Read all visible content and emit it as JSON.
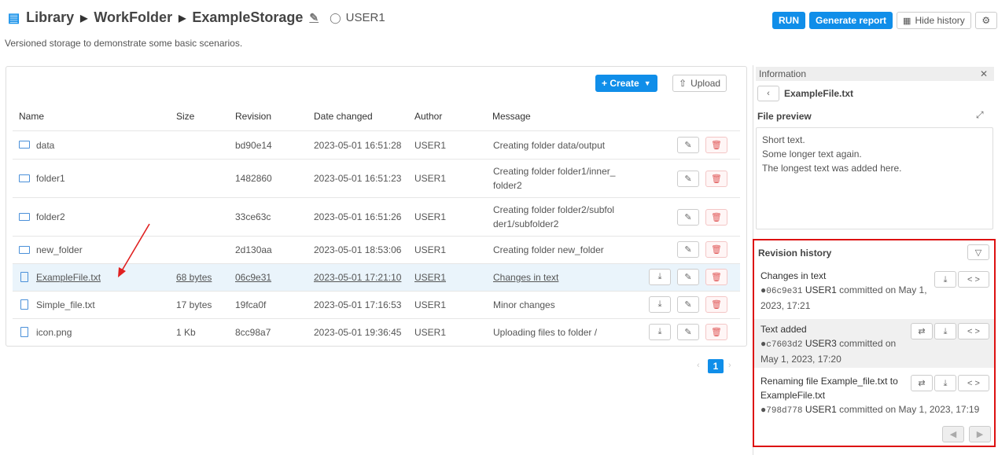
{
  "breadcrumb": {
    "root": "Library",
    "folder": "WorkFolder",
    "storage": "ExampleStorage",
    "user": "USER1"
  },
  "description": "Versioned storage to demonstrate some basic scenarios.",
  "toolbar": {
    "run": "RUN",
    "report": "Generate report",
    "hide_history": "Hide history"
  },
  "list": {
    "create": "+ Create",
    "upload": "Upload",
    "columns": [
      "Name",
      "Size",
      "Revision",
      "Date changed",
      "Author",
      "Message"
    ],
    "rows": [
      {
        "name": "data",
        "size": "",
        "rev": "bd90e14",
        "date": "2023-05-01 16:51:28",
        "author": "USER1",
        "msg1": "Creating folder data/output",
        "msg2": ""
      },
      {
        "name": "folder1",
        "size": "",
        "rev": "1482860",
        "date": "2023-05-01 16:51:23",
        "author": "USER1",
        "msg1": "Creating folder folder1/inner_",
        "msg2": "folder2"
      },
      {
        "name": "folder2",
        "size": "",
        "rev": "33ce63c",
        "date": "2023-05-01 16:51:26",
        "author": "USER1",
        "msg1": "Creating folder folder2/subfol",
        "msg2": "der1/subfolder2"
      },
      {
        "name": "new_folder",
        "size": "",
        "rev": "2d130aa",
        "date": "2023-05-01 18:53:06",
        "author": "USER1",
        "msg1": "Creating folder new_folder",
        "msg2": ""
      },
      {
        "name": "ExampleFile.txt",
        "size": "68 bytes",
        "rev": "06c9e31",
        "date": "2023-05-01 17:21:10",
        "author": "USER1",
        "msg1": "Changes in text",
        "msg2": ""
      },
      {
        "name": "Simple_file.txt",
        "size": "17 bytes",
        "rev": "19fca0f",
        "date": "2023-05-01 17:16:53",
        "author": "USER1",
        "msg1": "Minor changes",
        "msg2": ""
      },
      {
        "name": "icon.png",
        "size": "1 Kb",
        "rev": "8cc98a7",
        "date": "2023-05-01 19:36:45",
        "author": "USER1",
        "msg1": "Uploading files to folder /",
        "msg2": ""
      }
    ],
    "page": "1"
  },
  "info": {
    "title": "Information",
    "file": "ExampleFile.txt",
    "preview_label": "File preview",
    "preview_lines": [
      "Short text.",
      "Some longer text again.",
      "The longest text was added here."
    ]
  },
  "history": {
    "title": "Revision history",
    "items": [
      {
        "msg": "Changes in text",
        "hash": "06c9e31",
        "user": "USER1",
        "tail": "committed on May 1,",
        "tail2": "2023, 17:21"
      },
      {
        "msg": "Text added",
        "hash": "c7603d2",
        "user": "USER3",
        "tail": "committed on",
        "tail2": "May 1, 2023, 17:20"
      },
      {
        "msg": "Renaming file Example_file.txt to",
        "msg2": "ExampleFile.txt",
        "hash": "798d778",
        "user": "USER1",
        "tail": "committed on May 1, 2023, 17:19"
      }
    ]
  }
}
